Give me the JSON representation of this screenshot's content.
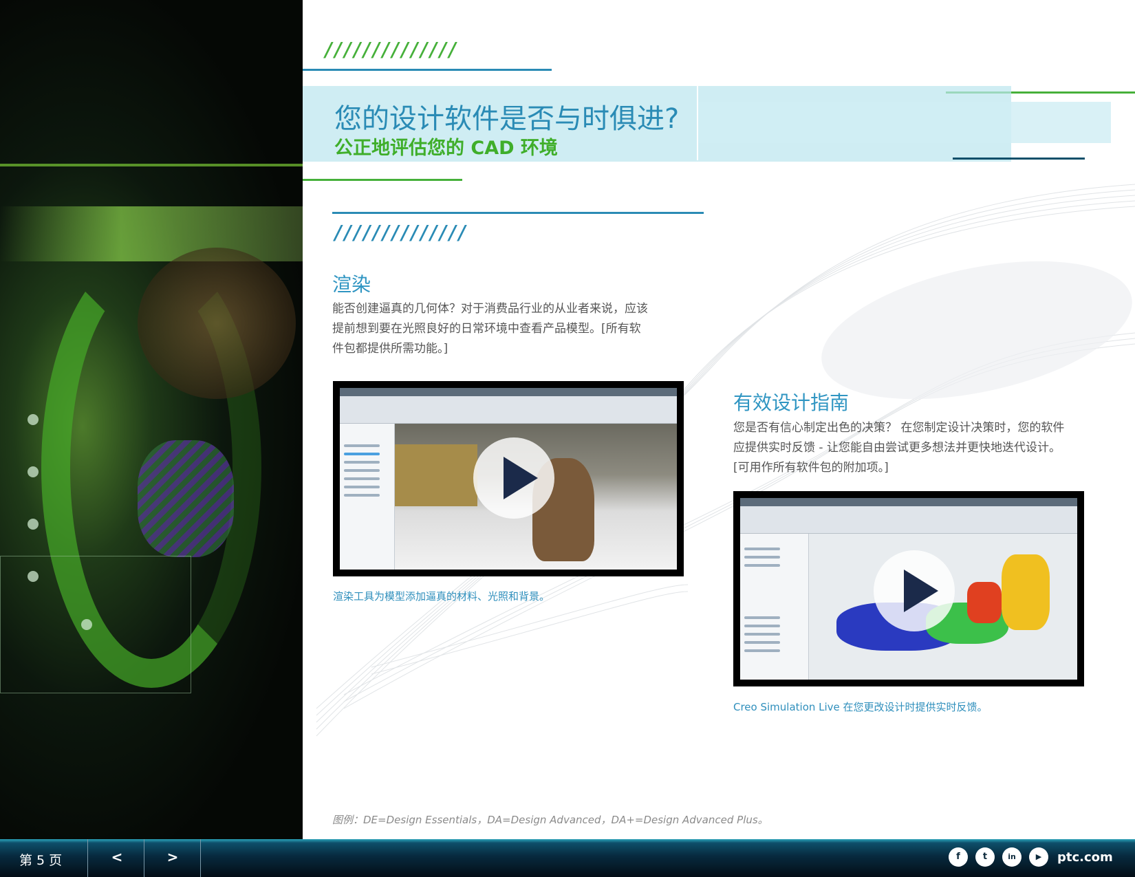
{
  "header": {
    "title": "您的设计软件是否与时俱进?",
    "subtitle": "公正地评估您的 CAD 环境"
  },
  "decor": {
    "hatch_top": "//////////////",
    "hatch_section": "//////////////"
  },
  "rendering": {
    "title": "渲染",
    "body": "能否创建逼真的几何体？对于消费品行业的从业者来说，应该提前想到要在光照良好的日常环境中查看产品模型。[所有软件包都提供所需功能。]",
    "video_caption": "渲染工具为模型添加逼真的材料、光照和背景。"
  },
  "guidance": {
    "title": "有效设计指南",
    "body": "您是否有信心制定出色的决策？ 在您制定设计决策时，您的软件应提供实时反馈 - 让您能自由尝试更多想法并更快地迭代设计。[可用作所有软件包的附加项。]",
    "video_caption": "Creo Simulation Live 在您更改设计时提供实时反馈。"
  },
  "legend": "图例：DE=Design Essentials，DA=Design Advanced，DA+=Design Advanced Plus。",
  "footer": {
    "page_label": "第 5 页",
    "prev": "<",
    "next": ">",
    "site": "ptc.com",
    "social": [
      "f",
      "t",
      "in",
      "▶"
    ]
  },
  "colors": {
    "accent_blue": "#2f95c2",
    "accent_green": "#3fae2a",
    "footer_dark": "#072a3e"
  },
  "icons": [
    "play-icon",
    "facebook-icon",
    "twitter-icon",
    "linkedin-icon",
    "youtube-icon"
  ]
}
